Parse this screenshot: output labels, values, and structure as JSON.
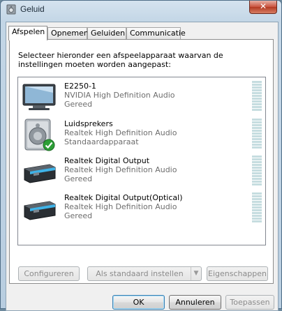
{
  "window": {
    "title": "Geluid",
    "close_label": "✕"
  },
  "tabs": [
    {
      "label": "Afspelen",
      "active": true
    },
    {
      "label": "Opnemen",
      "active": false
    },
    {
      "label": "Geluiden",
      "active": false
    },
    {
      "label": "Communicatie",
      "active": false
    }
  ],
  "description": "Selecteer hieronder een afspeelapparaat waarvan de instellingen moeten worden aangepast:",
  "devices": [
    {
      "name": "E2250-1",
      "driver": "NVIDIA High Definition Audio",
      "status": "Gereed",
      "icon": "monitor-icon"
    },
    {
      "name": "Luidsprekers",
      "driver": "Realtek High Definition Audio",
      "status": "Standaardapparaat",
      "icon": "speaker-icon",
      "default_check": "check-icon"
    },
    {
      "name": "Realtek Digital Output",
      "driver": "Realtek High Definition Audio",
      "status": "Gereed",
      "icon": "digital-output-icon"
    },
    {
      "name": "Realtek Digital Output(Optical)",
      "driver": "Realtek High Definition Audio",
      "status": "Gereed",
      "icon": "digital-output-icon"
    }
  ],
  "panel_buttons": {
    "configure": "Configureren",
    "set_default": "Als standaard instellen",
    "properties": "Eigenschappen"
  },
  "dialog_buttons": {
    "ok": "OK",
    "cancel": "Annuleren",
    "apply": "Toepassen"
  }
}
